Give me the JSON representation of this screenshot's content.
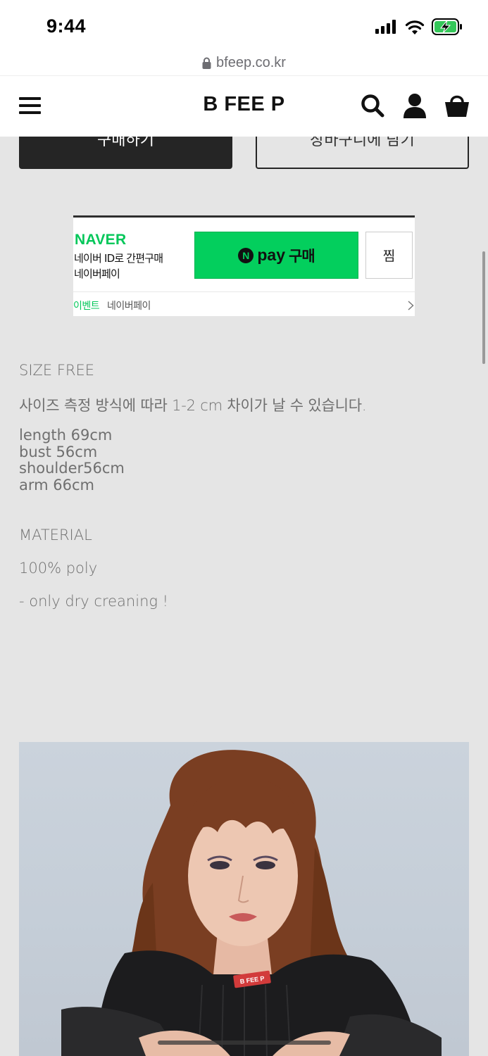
{
  "status_bar": {
    "time": "9:44",
    "icons": [
      "signal-icon",
      "wifi-icon",
      "battery-charging-icon"
    ]
  },
  "browser": {
    "url": "bfeep.co.kr",
    "lock_icon": "lock-icon"
  },
  "header": {
    "brand": "B FEE P",
    "icons": [
      "menu-icon",
      "search-icon",
      "user-icon",
      "cart-icon"
    ]
  },
  "action_buttons": {
    "buy": "구매하기",
    "cart": "장바구니에 담기"
  },
  "naver_pay": {
    "logo": "NAVER",
    "line1": "네이버 ID로 간편구매",
    "line2": "네이버페이",
    "pay_badge": "N",
    "pay_label": "pay",
    "buy_label": "구매",
    "wish_label": "찜",
    "event_label": "이벤트",
    "event_text": "네이버페이",
    "brand_color": "#03cf5d"
  },
  "product_info": {
    "size_title": "SIZE FREE",
    "size_note": "사이즈 측정 방식에 따라 1-2 cm 차이가 날 수 있습니다.",
    "measurements": [
      "length 69cm",
      "bust 56cm",
      "shoulder56cm",
      "arm 66cm"
    ],
    "material_title": "MATERIAL",
    "material": "100% poly",
    "care": "- only dry creaning !"
  },
  "product_photo": {
    "shirt_label": "B FEE P"
  }
}
